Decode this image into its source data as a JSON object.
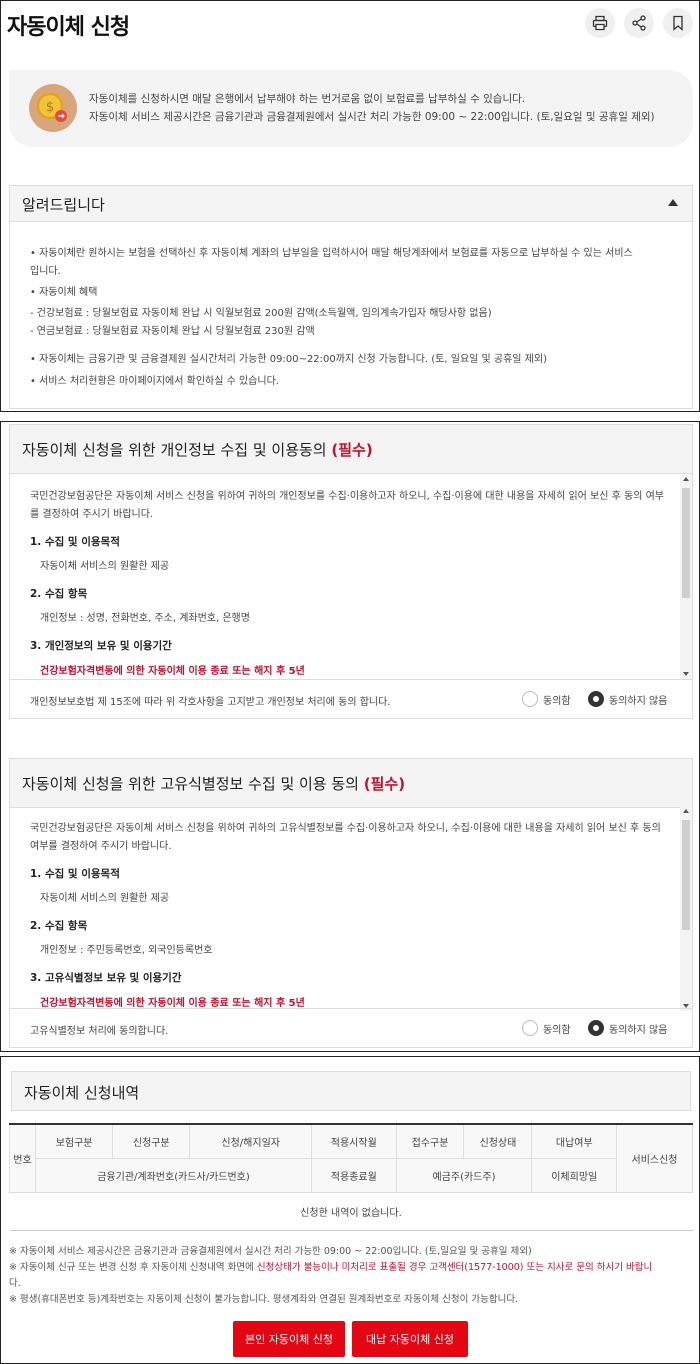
{
  "header": {
    "title": "자동이체 신청",
    "icons": [
      "print-icon",
      "share-icon",
      "bookmark-icon"
    ]
  },
  "intro": {
    "line1": "자동이체를 신청하시면 매달 은행에서 납부해야 하는 번거로움 없이 보험료를 납부하실 수 있습니다.",
    "line2": "자동이체 서비스 제공시간은 금융기관과 금융결제원에서 실시간 처리 가능한 09:00 ~ 22:00입니다. (토,일요일 및 공휴일 제외)"
  },
  "notice": {
    "title": "알려드립니다",
    "items": [
      "• 자동이체란 원하시는 보험을 선택하신 후 자동이체 계좌의 납부일을 입력하시어 매달 해당계좌에서 보험료를 자동으로 납부하실 수 있는 서비스",
      "   입니다.",
      "• 자동이체 혜택",
      "   - 건강보험료 : 당월보험료 자동이체 완납 시 익월보험료 200원 감액(소득월액, 임의계속가입자 해당사항 없음)",
      "   - 연금보험료 : 당월보험료 자동이체 완납 시 당월보험료 230원 감액",
      "• 자동이체는 금융기관 및 금융결제원 실시간처리 가능한 09:00~22:00까지 신청 가능합니다. (토, 일요일 및 공휴일 제외)",
      "• 서비스 처리현황은 마이페이지에서 확인하실 수 있습니다."
    ]
  },
  "consent1": {
    "title": "자동이체 신청을 위한 개인정보 수집 및 이용동의",
    "required": "(필수)",
    "intro": "국민건강보험공단은 자동이체 서비스 신청을 위하여 귀하의 개인정보를 수집·이용하고자 하오니, 수집·이용에 대한 내용을 자세히 읽어 보신 후 동의 여부를 결정하여 주시기 바랍니다.",
    "s1": "1. 수집 및 이용목적",
    "s1v": "자동이체 서비스의 원활한 제공",
    "s2": "2. 수집 항목",
    "s2v": "개인정보 : 성명, 전화번호, 주소, 계좌번호, 은행명",
    "s3": "3. 개인정보의 보유 및 이용기간",
    "s3v": "건강보험자격변동에 의한 자동이체 이용 종료 또는 해지 후 5년",
    "agree_text": "개인정보보호법 제 15조에 따라 위 각호사항을 고지받고 개인정보 처리에 동의 합니다.",
    "agree": "동의함",
    "disagree": "동의하지 않음"
  },
  "consent2": {
    "title": "자동이체 신청을 위한 고유식별정보 수집 및 이용 동의",
    "required": "(필수)",
    "intro": "국민건강보험공단은 자동이체 서비스 신청을 위하여 귀하의 고유식별정보를 수집·이용하고자 하오니, 수집·이용에 대한 내용을 자세히 읽어 보신 후 동의 여부를 결정하여 주시기 바랍니다.",
    "s1": "1. 수집 및 이용목적",
    "s1v": "자동이체 서비스의 원활한 제공",
    "s2": "2. 수집 항목",
    "s2v": "개인정보 : 주민등록번호, 외국인등록번호",
    "s3": "3. 고유식별정보 보유 및 이용기간",
    "s3v": "건강보험자격변동에 의한 자동이체 이용 종료 또는 해지 후 5년",
    "agree_text": "고유식별정보 처리에 동의합니다.",
    "agree": "동의함",
    "disagree": "동의하지 않음"
  },
  "history": {
    "title": "자동이체 신청내역",
    "col_no": "번호",
    "row1": [
      "보험구분",
      "신청구분",
      "신청/해지일자",
      "적용시작월",
      "접수구분",
      "신청상태",
      "대납여부"
    ],
    "row2": [
      "금융기관/계좌번호(카드사/카드번호)",
      "적용종료월",
      "예금주(카드주)",
      "이체희망일"
    ],
    "col_service": "서비스신청",
    "empty": "신청한 내역이 없습니다.",
    "note1": "※ 자동이체 서비스 제공시간은 금융기관과 금융결제원에서 실시간 처리 가능한 09:00 ~ 22:00입니다. (토,일요일 및 공휴일 제외)",
    "note2a": "※ 자동이체 신규 또는 변경 신청 후 자동이체 신청내역 화면에 ",
    "note2b": "신청상태가 불능이나 미처리로 표출될 경우 고객센터(1577-1000) 또는 지사로 문의 하시기 바랍니",
    "note2c": "다.",
    "note3": "※ 평생(휴대폰번호 등)계좌번호는 자동이체 신청이 불가능합니다. 평생계좌와 연결된 원계좌번호로 자동이체 신청이 가능합니다.",
    "btn_self": "본인 자동이체 신청",
    "btn_proxy": "대납 자동이체 신청"
  },
  "colors": {
    "accent": "#e30613",
    "required": "#c8102e"
  }
}
